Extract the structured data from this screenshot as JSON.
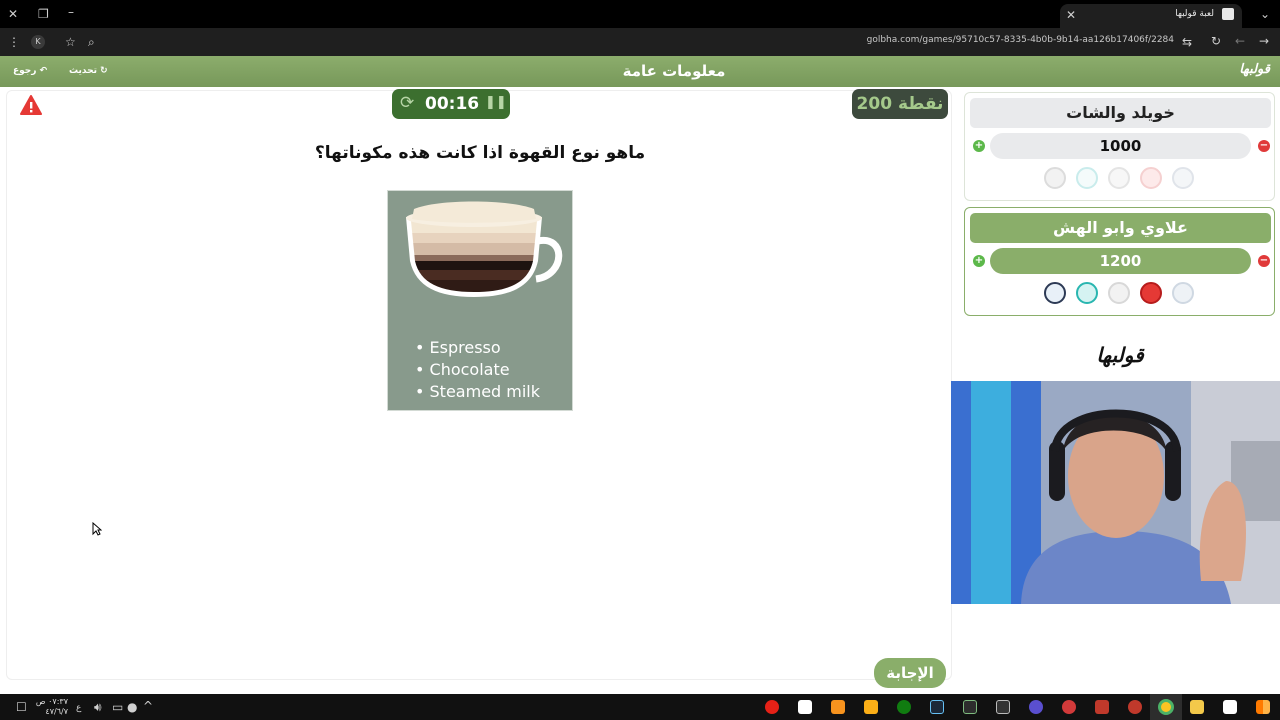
{
  "browser": {
    "tab_title": "لعبة قولبها",
    "url": "golbha.com/games/95710c57-8335-4b0b-9b14-aa126b17406f/2284",
    "profile_initial": "K"
  },
  "header": {
    "title": "معلومات عامة",
    "back_label": "رجوع",
    "refresh_label": "تحديث",
    "logo": "قولبها"
  },
  "game": {
    "timer": "00:16",
    "points": "200 نقطة",
    "question": "ماهو نوع القهوة اذا كانت هذه مكوناتها؟",
    "ingredients": [
      "• Espresso",
      "• Chocolate",
      "• Steamed milk"
    ],
    "answer_label": "الإجابة"
  },
  "teams": [
    {
      "name": "خويلد والشات",
      "score": "1000",
      "active": false
    },
    {
      "name": "علاوي وابو الهش",
      "score": "1200",
      "active": true
    }
  ],
  "side_logo": "قولبها",
  "taskbar": {
    "time": "٠٧:٣٧ ص",
    "date": "٤٧/٦/٧",
    "lang": "ع"
  },
  "colors": {
    "brand_green": "#8aae6a",
    "timer_green": "#3c6f2f",
    "danger": "#e03a3a"
  }
}
